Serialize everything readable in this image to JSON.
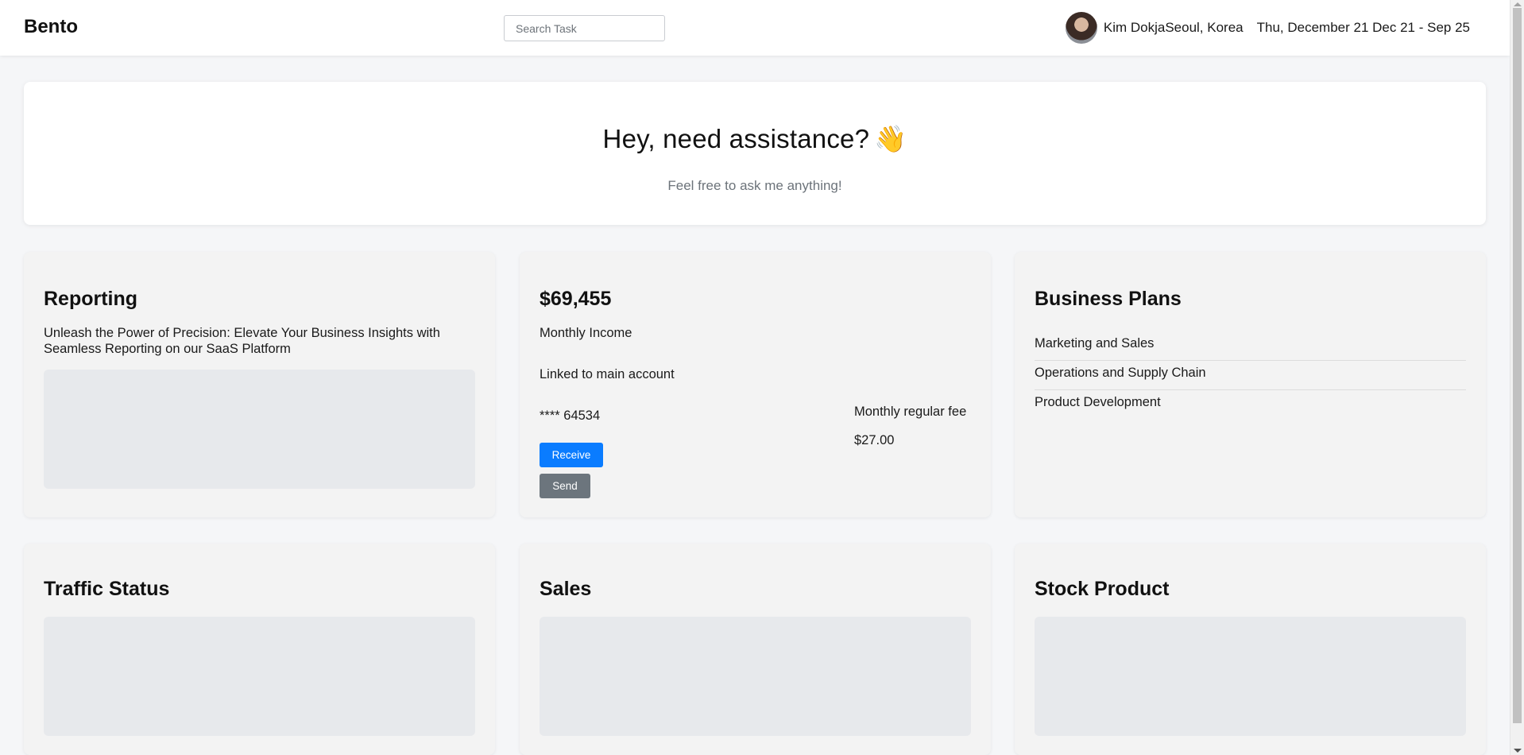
{
  "header": {
    "brand": "Bento",
    "search_placeholder": "Search Task",
    "user_name": "Kim DokjaSeoul, Korea",
    "date_range": "Thu, December 21 Dec 21 - Sep 25"
  },
  "hero": {
    "title": "Hey, need assistance?",
    "emoji": "👋",
    "subtitle": "Feel free to ask me anything!"
  },
  "reporting": {
    "title": "Reporting",
    "description": "Unleash the Power of Precision: Elevate Your Business Insights with Seamless Reporting on our SaaS Platform"
  },
  "income": {
    "amount": "$69,455",
    "label": "Monthly Income",
    "linked": "Linked to main account",
    "account": "**** 64534",
    "fee_label": "Monthly regular fee",
    "fee_value": "$27.00",
    "receive_label": "Receive",
    "send_label": "Send"
  },
  "business_plans": {
    "title": "Business Plans",
    "items": [
      "Marketing and Sales",
      "Operations and Supply Chain",
      "Product Development"
    ]
  },
  "traffic": {
    "title": "Traffic Status"
  },
  "sales": {
    "title": "Sales"
  },
  "stock": {
    "title": "Stock Product"
  },
  "colors": {
    "receive_button": "#0a7cff",
    "send_button": "#6c757d",
    "card_background": "#f3f3f3",
    "placeholder": "#e7e9ec"
  }
}
